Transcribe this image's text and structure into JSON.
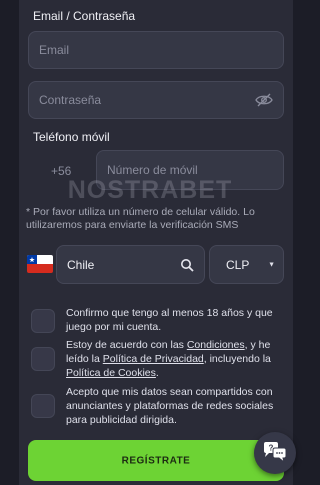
{
  "form": {
    "email_password_label": "Email / Contraseña",
    "email_placeholder": "Email",
    "password_placeholder": "Contraseña",
    "phone_label": "Teléfono móvil",
    "phone_code": "+56",
    "phone_placeholder": "Número de móvil",
    "phone_note": "* Por favor utiliza un número de celular válido. Lo utilizaremos para enviarte la verificación SMS",
    "country": "Chile",
    "currency": "CLP",
    "checkbox_age": "Confirmo que tengo al menos 18 años y que juego por mi cuenta.",
    "terms_prefix": "Estoy de acuerdo con las ",
    "terms_link": "Condiciones",
    "terms_middle": ", y he leído la ",
    "privacy_link": "Política de Privacidad",
    "terms_middle2": ", incluyendo la ",
    "cookies_link": "Política de Cookies",
    "terms_suffix": ".",
    "checkbox_marketing": "Acepto que mis datos sean compartidos con anunciantes y plataformas de redes sociales para publicidad dirigida.",
    "register_button": "REGÍSTRATE"
  },
  "watermark": "NOSTRABET",
  "icons": {
    "password_toggle": "eye-off-icon",
    "search": "search-icon",
    "dropdown": "caret-down-icon",
    "chat": "chat-bubbles-icon",
    "flag": "chile-flag-icon"
  },
  "colors": {
    "background": "#1c1d27",
    "panel": "#2a2b37",
    "field": "#353745",
    "accent_green": "#6dd334"
  }
}
